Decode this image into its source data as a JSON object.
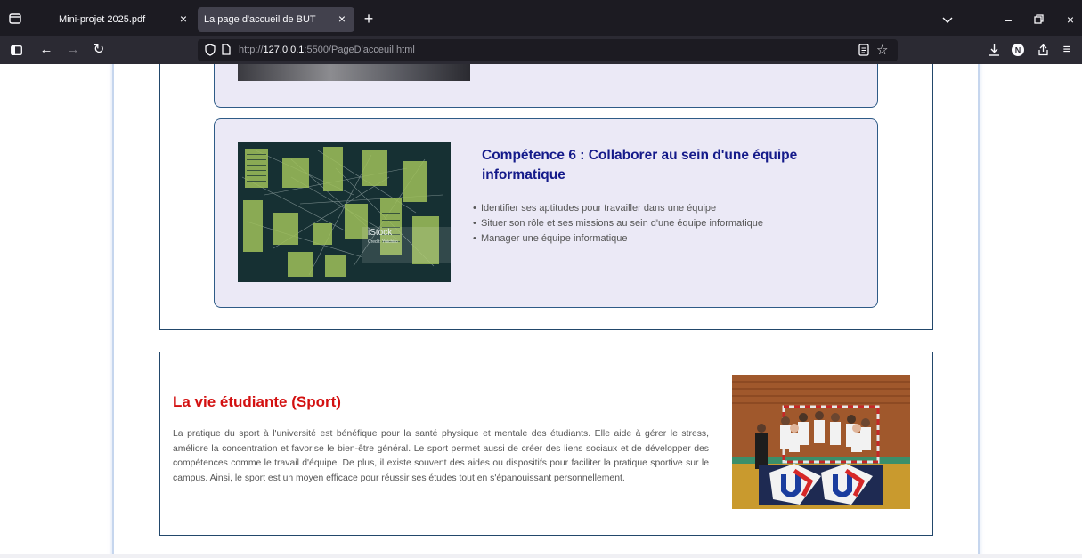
{
  "browser": {
    "tabs": [
      {
        "title": "Mini-projet 2025.pdf",
        "active": false
      },
      {
        "title": "La page d'accueil de BUT",
        "active": true
      }
    ],
    "url_prefix": "http://",
    "url_host": "127.0.0.1",
    "url_rest": ":5500/PageD'acceuil.html"
  },
  "competence6": {
    "title": "Compétence 6 : Collaborer au sein d'une équipe informatique",
    "items": [
      "Identifier ses aptitudes pour travailler dans une équipe",
      "Situer son rôle et ses missions au sein d'une équipe informatique",
      "Manager une équipe informatique"
    ],
    "image_watermark": "iStock",
    "image_credit": "Credit: Yuichiro"
  },
  "sport": {
    "title": "La vie étudiante (Sport)",
    "text": "La pratique du sport à l'université est bénéfique pour la santé physique et mentale des étudiants. Elle aide à gérer le stress, améliore la concentration et favorise le bien-être général. Le sport permet aussi de créer des liens sociaux et de développer des compétences comme le travail d'équipe. De plus, il existe souvent des aides ou dispositifs pour faciliter la pratique sportive sur le campus. Ainsi, le sport est un moyen efficace pour réussir ses études tout en s'épanouissant personnellement."
  },
  "colors": {
    "chrome_dark": "#1c1b22",
    "chrome_nav": "#2b2a33",
    "card_bg": "#ebe9f6",
    "card_border": "#2e5b87",
    "competence_title": "#141a8a",
    "sport_title": "#d31111"
  }
}
